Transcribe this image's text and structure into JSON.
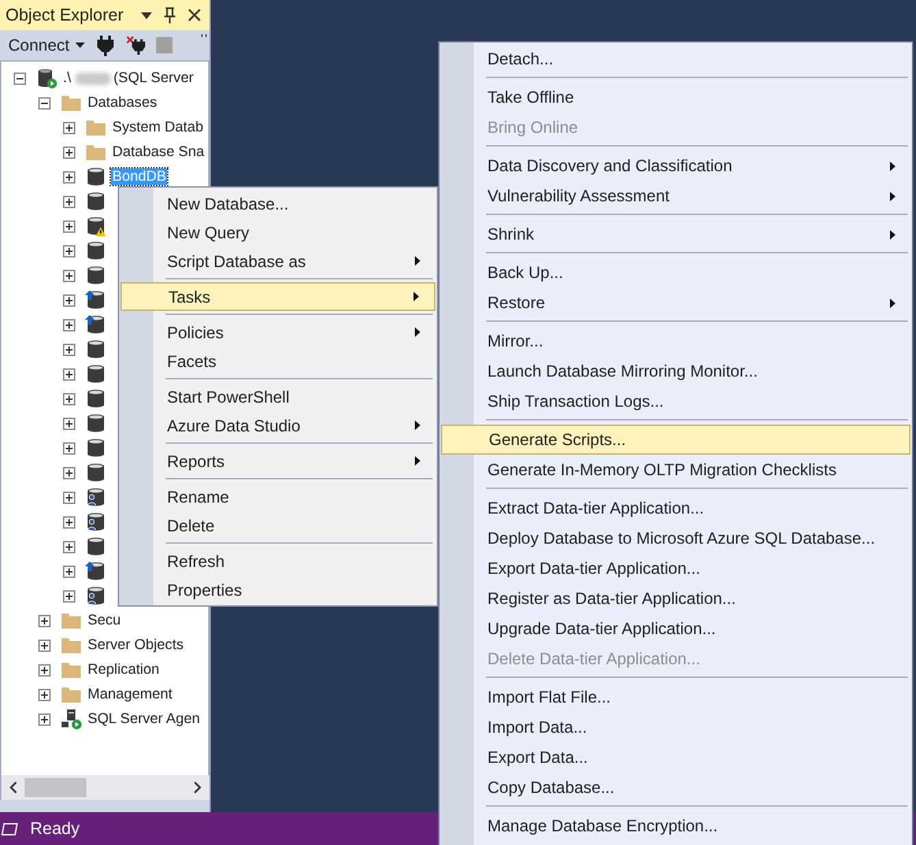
{
  "panel": {
    "title": "Object Explorer",
    "connect": "Connect"
  },
  "tree": [
    {
      "kind": "server",
      "label": ".\\",
      "redacted": true,
      "suffix": "(SQL Server",
      "expanded": true,
      "selected": false,
      "children": [
        {
          "kind": "folder",
          "label": "Databases",
          "expanded": true,
          "selected": false,
          "children": [
            {
              "kind": "folder",
              "label": "System Datab",
              "expanded": false,
              "selected": false
            },
            {
              "kind": "folder",
              "label": "Database Sna",
              "expanded": false,
              "selected": false
            },
            {
              "kind": "database",
              "label": "BondDB",
              "expanded": false,
              "selected": true
            },
            {
              "kind": "database",
              "expanded": false
            },
            {
              "kind": "database-warning",
              "expanded": false
            },
            {
              "kind": "database",
              "expanded": false
            },
            {
              "kind": "database",
              "expanded": false
            },
            {
              "kind": "database-up",
              "expanded": false
            },
            {
              "kind": "database-up",
              "expanded": false
            },
            {
              "kind": "database",
              "expanded": false
            },
            {
              "kind": "database",
              "expanded": false
            },
            {
              "kind": "database",
              "expanded": false
            },
            {
              "kind": "database",
              "expanded": false
            },
            {
              "kind": "database",
              "expanded": false
            },
            {
              "kind": "database",
              "expanded": false
            },
            {
              "kind": "database-user",
              "expanded": false
            },
            {
              "kind": "database-user",
              "expanded": false
            },
            {
              "kind": "database",
              "expanded": false
            },
            {
              "kind": "database-up",
              "expanded": false
            },
            {
              "kind": "database-user",
              "expanded": false
            }
          ]
        },
        {
          "kind": "folder",
          "label": "Secu",
          "expanded": false,
          "selected": false
        },
        {
          "kind": "folder",
          "label": "Server Objects",
          "expanded": false,
          "selected": false
        },
        {
          "kind": "folder",
          "label": "Replication",
          "expanded": false,
          "selected": false
        },
        {
          "kind": "folder",
          "label": "Management",
          "expanded": false,
          "selected": false
        },
        {
          "kind": "agent",
          "label": "SQL Server Agen",
          "expanded": false,
          "selected": false
        }
      ]
    }
  ],
  "context_menu": [
    {
      "kind": "item",
      "label": "New Database...",
      "submenu": false,
      "selected": false
    },
    {
      "kind": "item",
      "label": "New Query",
      "submenu": false,
      "selected": false
    },
    {
      "kind": "item",
      "label": "Script Database as",
      "submenu": true,
      "selected": false
    },
    {
      "kind": "separator"
    },
    {
      "kind": "item",
      "label": "Tasks",
      "submenu": true,
      "selected": true
    },
    {
      "kind": "separator"
    },
    {
      "kind": "item",
      "label": "Policies",
      "submenu": true,
      "selected": false
    },
    {
      "kind": "item",
      "label": "Facets",
      "submenu": false,
      "selected": false
    },
    {
      "kind": "separator"
    },
    {
      "kind": "item",
      "label": "Start PowerShell",
      "submenu": false,
      "selected": false
    },
    {
      "kind": "item",
      "label": "Azure Data Studio",
      "submenu": true,
      "selected": false
    },
    {
      "kind": "separator"
    },
    {
      "kind": "item",
      "label": "Reports",
      "submenu": true,
      "selected": false
    },
    {
      "kind": "separator"
    },
    {
      "kind": "item",
      "label": "Rename",
      "submenu": false,
      "selected": false
    },
    {
      "kind": "item",
      "label": "Delete",
      "submenu": false,
      "selected": false
    },
    {
      "kind": "separator"
    },
    {
      "kind": "item",
      "label": "Refresh",
      "submenu": false,
      "selected": false
    },
    {
      "kind": "item",
      "label": "Properties",
      "submenu": false,
      "selected": false
    }
  ],
  "tasks_menu": [
    {
      "kind": "item",
      "label": "Detach...",
      "submenu": false,
      "selected": false,
      "disabled": false
    },
    {
      "kind": "separator"
    },
    {
      "kind": "item",
      "label": "Take Offline",
      "submenu": false,
      "selected": false,
      "disabled": false
    },
    {
      "kind": "item",
      "label": "Bring Online",
      "submenu": false,
      "selected": false,
      "disabled": true
    },
    {
      "kind": "separator"
    },
    {
      "kind": "item",
      "label": "Data Discovery and Classification",
      "submenu": true,
      "selected": false,
      "disabled": false
    },
    {
      "kind": "item",
      "label": "Vulnerability Assessment",
      "submenu": true,
      "selected": false,
      "disabled": false
    },
    {
      "kind": "separator"
    },
    {
      "kind": "item",
      "label": "Shrink",
      "submenu": true,
      "selected": false,
      "disabled": false
    },
    {
      "kind": "separator"
    },
    {
      "kind": "item",
      "label": "Back Up...",
      "submenu": false,
      "selected": false,
      "disabled": false
    },
    {
      "kind": "item",
      "label": "Restore",
      "submenu": true,
      "selected": false,
      "disabled": false
    },
    {
      "kind": "separator"
    },
    {
      "kind": "item",
      "label": "Mirror...",
      "submenu": false,
      "selected": false,
      "disabled": false
    },
    {
      "kind": "item",
      "label": "Launch Database Mirroring Monitor...",
      "submenu": false,
      "selected": false,
      "disabled": false
    },
    {
      "kind": "item",
      "label": "Ship Transaction Logs...",
      "submenu": false,
      "selected": false,
      "disabled": false
    },
    {
      "kind": "separator"
    },
    {
      "kind": "item",
      "label": "Generate Scripts...",
      "submenu": false,
      "selected": true,
      "disabled": false
    },
    {
      "kind": "item",
      "label": "Generate In-Memory OLTP Migration Checklists",
      "submenu": false,
      "selected": false,
      "disabled": false
    },
    {
      "kind": "separator"
    },
    {
      "kind": "item",
      "label": "Extract Data-tier Application...",
      "submenu": false,
      "selected": false,
      "disabled": false
    },
    {
      "kind": "item",
      "label": "Deploy Database to Microsoft Azure SQL Database...",
      "submenu": false,
      "selected": false,
      "disabled": false
    },
    {
      "kind": "item",
      "label": "Export Data-tier Application...",
      "submenu": false,
      "selected": false,
      "disabled": false
    },
    {
      "kind": "item",
      "label": "Register as Data-tier Application...",
      "submenu": false,
      "selected": false,
      "disabled": false
    },
    {
      "kind": "item",
      "label": "Upgrade Data-tier Application...",
      "submenu": false,
      "selected": false,
      "disabled": false
    },
    {
      "kind": "item",
      "label": "Delete Data-tier Application...",
      "submenu": false,
      "selected": false,
      "disabled": true
    },
    {
      "kind": "separator"
    },
    {
      "kind": "item",
      "label": "Import Flat File...",
      "submenu": false,
      "selected": false,
      "disabled": false
    },
    {
      "kind": "item",
      "label": "Import Data...",
      "submenu": false,
      "selected": false,
      "disabled": false
    },
    {
      "kind": "item",
      "label": "Export Data...",
      "submenu": false,
      "selected": false,
      "disabled": false
    },
    {
      "kind": "item",
      "label": "Copy Database...",
      "submenu": false,
      "selected": false,
      "disabled": false
    },
    {
      "kind": "separator"
    },
    {
      "kind": "item",
      "label": "Manage Database Encryption...",
      "submenu": false,
      "selected": false,
      "disabled": false
    }
  ],
  "status_bar": {
    "text": "Ready"
  }
}
